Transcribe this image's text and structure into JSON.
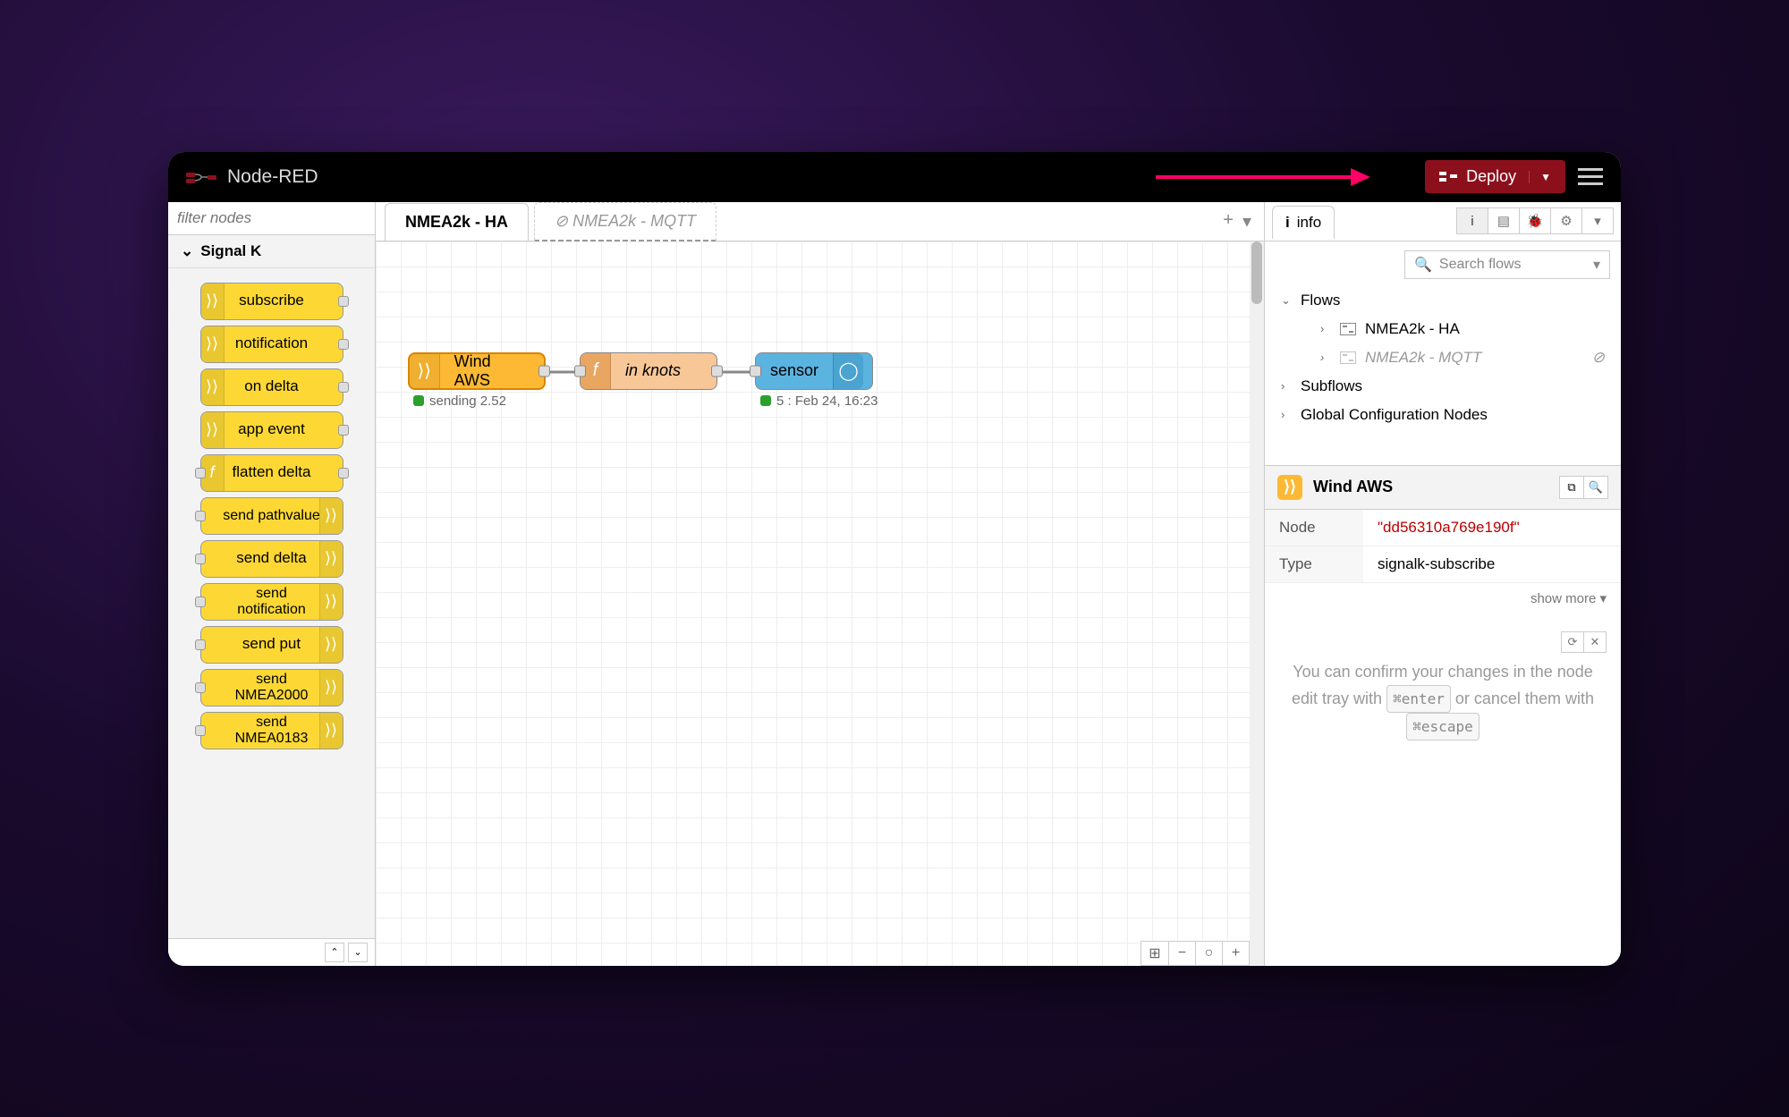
{
  "app": {
    "title": "Node-RED"
  },
  "header": {
    "deploy": "Deploy"
  },
  "palette": {
    "filter_placeholder": "filter nodes",
    "category": "Signal K",
    "nodes": [
      "subscribe",
      "notification",
      "on delta",
      "app event",
      "flatten delta",
      "send pathvalue",
      "send delta",
      "send notification",
      "send put",
      "send NMEA2000",
      "send NMEA0183"
    ]
  },
  "tabs": {
    "active": "NMEA2k - HA",
    "disabled": "NMEA2k - MQTT"
  },
  "flow": {
    "wind": {
      "label": "Wind AWS",
      "status": "sending 2.52"
    },
    "knots": {
      "label": "in knots"
    },
    "sensor": {
      "label": "sensor",
      "status": "5 : Feb 24, 16:23"
    }
  },
  "sidebar": {
    "tab": "info",
    "search_placeholder": "Search flows",
    "tree": {
      "flows": "Flows",
      "flow1": "NMEA2k - HA",
      "flow2": "NMEA2k - MQTT",
      "subflows": "Subflows",
      "global": "Global Configuration Nodes"
    },
    "node_title": "Wind AWS",
    "node_label": "Node",
    "node_id": "\"dd56310a769e190f\"",
    "type_label": "Type",
    "type_value": "signalk-subscribe",
    "show_more": "show more",
    "tip_before": "You can confirm your changes in the node edit tray with",
    "tip_enter": "⌘enter",
    "tip_mid": "or cancel them with",
    "tip_escape": "⌘escape"
  }
}
